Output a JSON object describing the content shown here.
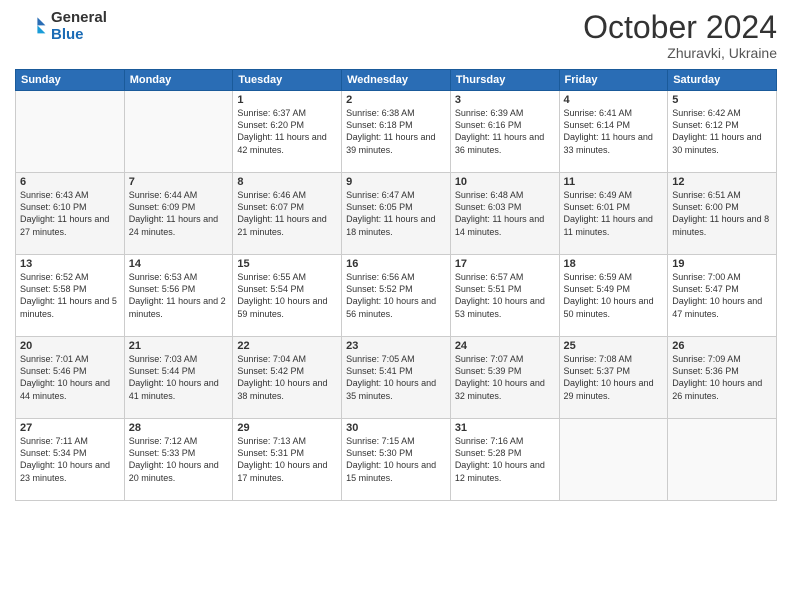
{
  "logo": {
    "general": "General",
    "blue": "Blue"
  },
  "header": {
    "month": "October 2024",
    "location": "Zhuravki, Ukraine"
  },
  "weekdays": [
    "Sunday",
    "Monday",
    "Tuesday",
    "Wednesday",
    "Thursday",
    "Friday",
    "Saturday"
  ],
  "weeks": [
    [
      null,
      null,
      {
        "day": 1,
        "sunrise": "6:37 AM",
        "sunset": "6:20 PM",
        "daylight": "11 hours and 42 minutes"
      },
      {
        "day": 2,
        "sunrise": "6:38 AM",
        "sunset": "6:18 PM",
        "daylight": "11 hours and 39 minutes"
      },
      {
        "day": 3,
        "sunrise": "6:39 AM",
        "sunset": "6:16 PM",
        "daylight": "11 hours and 36 minutes"
      },
      {
        "day": 4,
        "sunrise": "6:41 AM",
        "sunset": "6:14 PM",
        "daylight": "11 hours and 33 minutes"
      },
      {
        "day": 5,
        "sunrise": "6:42 AM",
        "sunset": "6:12 PM",
        "daylight": "11 hours and 30 minutes"
      }
    ],
    [
      {
        "day": 6,
        "sunrise": "6:43 AM",
        "sunset": "6:10 PM",
        "daylight": "11 hours and 27 minutes"
      },
      {
        "day": 7,
        "sunrise": "6:44 AM",
        "sunset": "6:09 PM",
        "daylight": "11 hours and 24 minutes"
      },
      {
        "day": 8,
        "sunrise": "6:46 AM",
        "sunset": "6:07 PM",
        "daylight": "11 hours and 21 minutes"
      },
      {
        "day": 9,
        "sunrise": "6:47 AM",
        "sunset": "6:05 PM",
        "daylight": "11 hours and 18 minutes"
      },
      {
        "day": 10,
        "sunrise": "6:48 AM",
        "sunset": "6:03 PM",
        "daylight": "11 hours and 14 minutes"
      },
      {
        "day": 11,
        "sunrise": "6:49 AM",
        "sunset": "6:01 PM",
        "daylight": "11 hours and 11 minutes"
      },
      {
        "day": 12,
        "sunrise": "6:51 AM",
        "sunset": "6:00 PM",
        "daylight": "11 hours and 8 minutes"
      }
    ],
    [
      {
        "day": 13,
        "sunrise": "6:52 AM",
        "sunset": "5:58 PM",
        "daylight": "11 hours and 5 minutes"
      },
      {
        "day": 14,
        "sunrise": "6:53 AM",
        "sunset": "5:56 PM",
        "daylight": "11 hours and 2 minutes"
      },
      {
        "day": 15,
        "sunrise": "6:55 AM",
        "sunset": "5:54 PM",
        "daylight": "10 hours and 59 minutes"
      },
      {
        "day": 16,
        "sunrise": "6:56 AM",
        "sunset": "5:52 PM",
        "daylight": "10 hours and 56 minutes"
      },
      {
        "day": 17,
        "sunrise": "6:57 AM",
        "sunset": "5:51 PM",
        "daylight": "10 hours and 53 minutes"
      },
      {
        "day": 18,
        "sunrise": "6:59 AM",
        "sunset": "5:49 PM",
        "daylight": "10 hours and 50 minutes"
      },
      {
        "day": 19,
        "sunrise": "7:00 AM",
        "sunset": "5:47 PM",
        "daylight": "10 hours and 47 minutes"
      }
    ],
    [
      {
        "day": 20,
        "sunrise": "7:01 AM",
        "sunset": "5:46 PM",
        "daylight": "10 hours and 44 minutes"
      },
      {
        "day": 21,
        "sunrise": "7:03 AM",
        "sunset": "5:44 PM",
        "daylight": "10 hours and 41 minutes"
      },
      {
        "day": 22,
        "sunrise": "7:04 AM",
        "sunset": "5:42 PM",
        "daylight": "10 hours and 38 minutes"
      },
      {
        "day": 23,
        "sunrise": "7:05 AM",
        "sunset": "5:41 PM",
        "daylight": "10 hours and 35 minutes"
      },
      {
        "day": 24,
        "sunrise": "7:07 AM",
        "sunset": "5:39 PM",
        "daylight": "10 hours and 32 minutes"
      },
      {
        "day": 25,
        "sunrise": "7:08 AM",
        "sunset": "5:37 PM",
        "daylight": "10 hours and 29 minutes"
      },
      {
        "day": 26,
        "sunrise": "7:09 AM",
        "sunset": "5:36 PM",
        "daylight": "10 hours and 26 minutes"
      }
    ],
    [
      {
        "day": 27,
        "sunrise": "7:11 AM",
        "sunset": "5:34 PM",
        "daylight": "10 hours and 23 minutes"
      },
      {
        "day": 28,
        "sunrise": "7:12 AM",
        "sunset": "5:33 PM",
        "daylight": "10 hours and 20 minutes"
      },
      {
        "day": 29,
        "sunrise": "7:13 AM",
        "sunset": "5:31 PM",
        "daylight": "10 hours and 17 minutes"
      },
      {
        "day": 30,
        "sunrise": "7:15 AM",
        "sunset": "5:30 PM",
        "daylight": "10 hours and 15 minutes"
      },
      {
        "day": 31,
        "sunrise": "7:16 AM",
        "sunset": "5:28 PM",
        "daylight": "10 hours and 12 minutes"
      },
      null,
      null
    ]
  ],
  "labels": {
    "sunrise": "Sunrise:",
    "sunset": "Sunset:",
    "daylight": "Daylight:"
  }
}
